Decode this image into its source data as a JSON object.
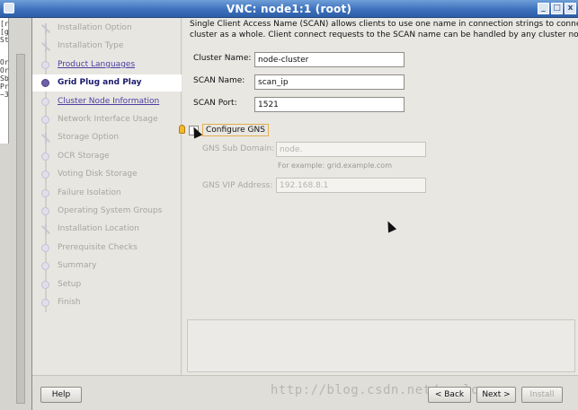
{
  "window": {
    "title": "VNC: node1:1 (root)",
    "minimize": "_",
    "maximize": "□",
    "close": "x"
  },
  "terminal": {
    "lines": [
      "[r",
      "[g",
      "St",
      "",
      "",
      "Or",
      "Or",
      "Sb",
      "Pr",
      "~3"
    ]
  },
  "steps": [
    {
      "label": "Installation Option",
      "state": "done",
      "icon": "branch"
    },
    {
      "label": "Installation Type",
      "state": "done",
      "icon": "branch"
    },
    {
      "label": "Product Languages",
      "state": "link",
      "icon": "dot"
    },
    {
      "label": "Grid Plug and Play",
      "state": "active",
      "icon": "dot"
    },
    {
      "label": "Cluster Node Information",
      "state": "link",
      "icon": "dot"
    },
    {
      "label": "Network Interface Usage",
      "state": "pending",
      "icon": "dot"
    },
    {
      "label": "Storage Option",
      "state": "pending",
      "icon": "branch"
    },
    {
      "label": "OCR Storage",
      "state": "pending",
      "icon": "dot"
    },
    {
      "label": "Voting Disk Storage",
      "state": "pending",
      "icon": "dot"
    },
    {
      "label": "Failure Isolation",
      "state": "pending",
      "icon": "dot"
    },
    {
      "label": "Operating System Groups",
      "state": "pending",
      "icon": "dot"
    },
    {
      "label": "Installation Location",
      "state": "pending",
      "icon": "branch"
    },
    {
      "label": "Prerequisite Checks",
      "state": "pending",
      "icon": "dot"
    },
    {
      "label": "Summary",
      "state": "pending",
      "icon": "dot"
    },
    {
      "label": "Setup",
      "state": "pending",
      "icon": "dot"
    },
    {
      "label": "Finish",
      "state": "pending",
      "icon": "dot"
    }
  ],
  "content": {
    "description_line1": "Single Client Access Name (SCAN) allows clients to use one name in connection strings to connec",
    "description_line2": "cluster as a whole. Client connect requests to the SCAN name can be handled by any cluster node",
    "cluster_name_label": "Cluster Name:",
    "cluster_name_value": "node-cluster",
    "scan_name_label": "SCAN Name:",
    "scan_name_value": "scan_ip",
    "scan_port_label": "SCAN Port:",
    "scan_port_value": "1521",
    "configure_gns_label": "Configure GNS",
    "gns_subdomain_label": "GNS Sub Domain:",
    "gns_subdomain_placeholder": "node.",
    "gns_subdomain_example": "For example: grid.example.com",
    "gns_vip_label": "GNS VIP Address:",
    "gns_vip_placeholder": "192.168.8.1"
  },
  "buttons": {
    "help": "Help",
    "back": "< Back",
    "next": "Next >",
    "install": "Install"
  },
  "watermark": "http://blog.csdn.net/yanlong",
  "colors": {
    "title_bar": "#3e72bd",
    "active_step_text": "#1b1b6e",
    "link_text": "#4a3fa3",
    "highlight_border": "#e0ad50"
  }
}
